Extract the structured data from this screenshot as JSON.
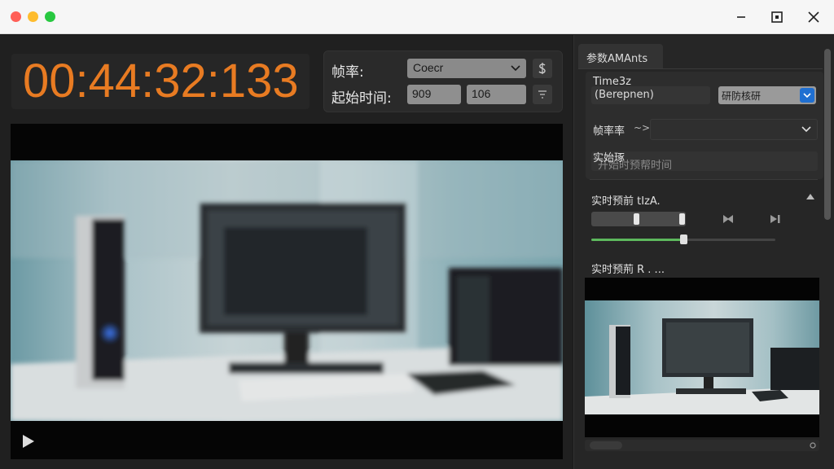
{
  "window": {
    "controls": {
      "minimize_icon": "minimize-icon",
      "maximize_icon": "maximize-icon",
      "close_icon": "close-icon"
    }
  },
  "timecode": {
    "value": "00:44:32:133",
    "color": "#e87b22"
  },
  "params": {
    "fps_label": "帧率:",
    "fps_value": "Coecr",
    "start_label": "起始时间:",
    "start_value_1": "909",
    "start_value_2": "106"
  },
  "video": {
    "play_icon": "play-icon"
  },
  "right_panel": {
    "tab_label": "参数AMAnts",
    "time_label": "Time3z",
    "time_value": "(Berepnen)",
    "mode_value": "研防核研",
    "fps_label": "帧率率",
    "fps_arrow": "~>",
    "start_label": "实始琢",
    "start_value": "开始时预帮时间",
    "preview_title": "实时预前 tIzA.",
    "preview2_title": "实时预荊 R . ...",
    "progress_fraction": 0.5,
    "accent_green": "#5db85d",
    "accent_blue": "#1f6fd1"
  }
}
